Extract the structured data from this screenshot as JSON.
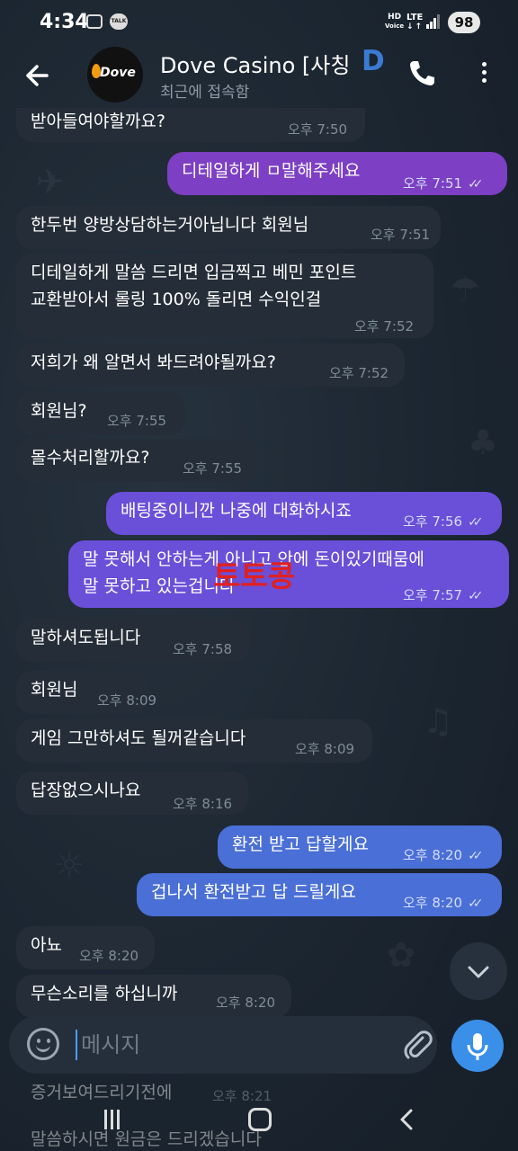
{
  "status_bar": {
    "time": "4:34",
    "talk_label": "TALK",
    "hd_label": "HD",
    "voice_label": "Voice",
    "lte_label": "LTE",
    "battery": "98"
  },
  "header": {
    "title": "Dove Casino [사칭",
    "title_suffix": "D",
    "subtitle": "최근에 접속함",
    "avatar_text": "Dove"
  },
  "messages": [
    {
      "text": "받아들여야할까요?",
      "time": "오후 7:50"
    },
    {
      "text": "디테일하게 ㅁ말해주세요",
      "time": "오후 7:51"
    },
    {
      "text": "한두번 양방상담하는거아닙니다 회원님",
      "time": "오후 7:51"
    },
    {
      "text": "디테일하게 말씀 드리면 입금찍고 베민 포인트",
      "text2": "교환받아서 롤링 100% 돌리면 수익인걸",
      "time": "오후 7:52"
    },
    {
      "text": "저희가 왜 알면서 봐드려야될까요?",
      "time": "오후 7:52"
    },
    {
      "text": "회원님?",
      "time": "오후 7:55"
    },
    {
      "text": "몰수처리할까요?",
      "time": "오후 7:55"
    },
    {
      "text": "배팅중이니깐 나중에 대화하시죠",
      "time": "오후 7:56"
    },
    {
      "text": "말 못해서 안하는게 아니고 안에 돈이있기때뭄에",
      "text2": "말 못하고 있는겁니다",
      "time": "오후 7:57"
    },
    {
      "text": "말하셔도됩니다",
      "time": "오후 7:58"
    },
    {
      "text": "회원님",
      "time": "오후 8:09"
    },
    {
      "text": "게임 그만하셔도 될꺼같습니다",
      "time": "오후 8:09"
    },
    {
      "text": "답장없으시나요",
      "time": "오후 8:16"
    },
    {
      "text": "환전 받고 답할게요",
      "time": "오후 8:20"
    },
    {
      "text": "겁나서 환전받고 답 드릴게요",
      "time": "오후 8:20"
    },
    {
      "text": "아뇨",
      "time": "오후 8:20"
    },
    {
      "text": "무슨소리를 하십니까",
      "time": "오후 8:20"
    },
    {
      "text": "증거보여드리기전에",
      "time": "오후 8:21"
    },
    {
      "text": "말씀하시면 원금은 드리겠습니다",
      "time": ""
    }
  ],
  "watermark": "토토콩",
  "input": {
    "placeholder": "메시지"
  },
  "colors": {
    "purple": "#7d3fc4",
    "violet": "#6a4fd8",
    "blue": "#4a6fd6",
    "incoming": "#252e38",
    "background": "#1c2733"
  }
}
